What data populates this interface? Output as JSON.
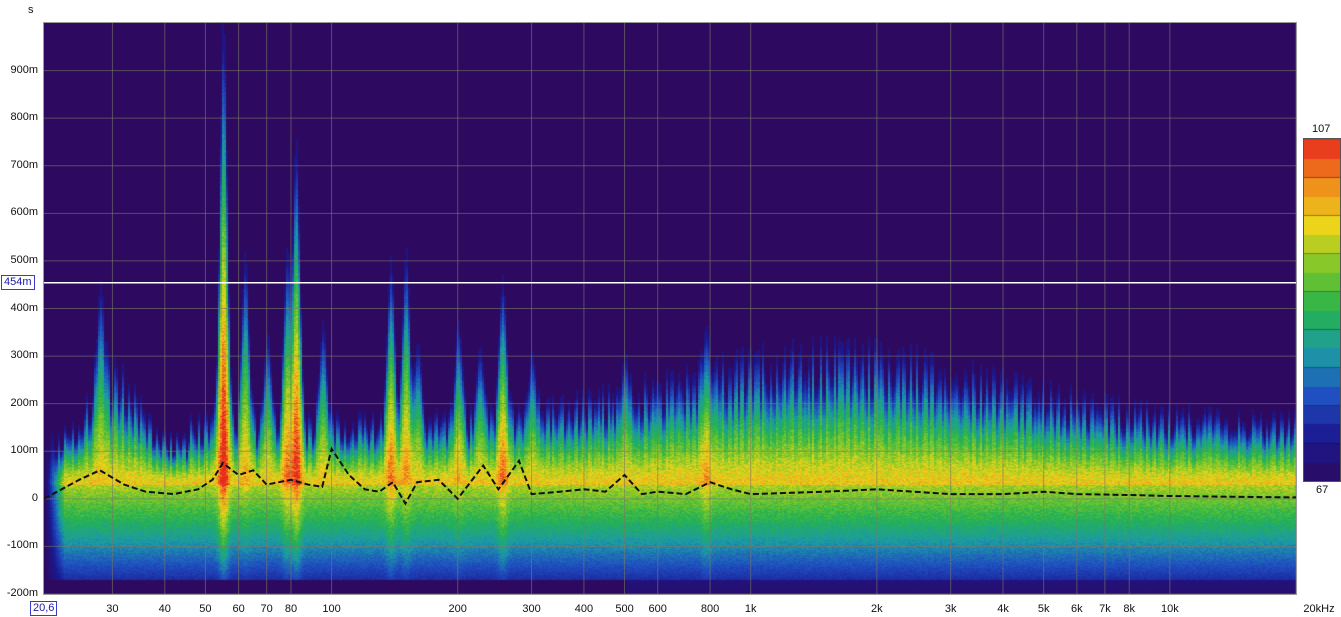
{
  "axis_labels": {
    "y_unit": "s",
    "y_ticks": [
      "900m",
      "800m",
      "700m",
      "600m",
      "500m",
      "400m",
      "300m",
      "200m",
      "100m",
      "0",
      "-100m",
      "-200m"
    ],
    "x_ticks": [
      "30",
      "40",
      "50",
      "60",
      "70",
      "80",
      "100",
      "200",
      "300",
      "400",
      "500",
      "600",
      "800",
      "1k",
      "2k",
      "3k",
      "4k",
      "5k",
      "6k",
      "7k",
      "8k",
      "10k",
      "20kHz"
    ],
    "x_start": "20,6",
    "y_cursor": "454m"
  },
  "colorbar": {
    "max_label": "107",
    "min_label": "67"
  },
  "colors": {
    "background": "#2d0a60",
    "gradient": [
      "#2d0a60",
      "#1b1890",
      "#1f4fc0",
      "#1c9aa6",
      "#26b34f",
      "#7cc72a",
      "#ecd41a",
      "#f08a1c",
      "#e8271e"
    ],
    "gridline": "#7a7a66",
    "cursor_line": "#ffffff",
    "peak_curve": "#111111"
  },
  "chart_data": {
    "type": "heatmap",
    "description_of_axes": "x: frequency (Hz, log scale); y: time (s); color: level (dB)",
    "x_scale": "log",
    "xlim_hz": [
      20.6,
      20000
    ],
    "ylim_s": [
      -0.2,
      1.0
    ],
    "x_tick_values_hz": [
      30,
      40,
      50,
      60,
      70,
      80,
      100,
      200,
      300,
      400,
      500,
      600,
      800,
      1000,
      2000,
      3000,
      4000,
      5000,
      6000,
      7000,
      8000,
      10000,
      20000
    ],
    "y_tick_values_s": [
      0.9,
      0.8,
      0.7,
      0.6,
      0.5,
      0.4,
      0.3,
      0.2,
      0.1,
      0,
      -0.1,
      -0.2
    ],
    "cursor_time_s": 0.454,
    "color_range_db": [
      67,
      107
    ],
    "decay_ridges": [
      {
        "freq_hz": 28,
        "top_s": 0.44,
        "strength": 0.7
      },
      {
        "freq_hz": 55,
        "top_s": 0.98,
        "strength": 1.0
      },
      {
        "freq_hz": 62,
        "top_s": 0.5,
        "strength": 0.75
      },
      {
        "freq_hz": 70,
        "top_s": 0.34,
        "strength": 0.6
      },
      {
        "freq_hz": 78,
        "top_s": 0.5,
        "strength": 0.85
      },
      {
        "freq_hz": 82,
        "top_s": 0.73,
        "strength": 0.95
      },
      {
        "freq_hz": 95,
        "top_s": 0.36,
        "strength": 0.7
      },
      {
        "freq_hz": 138,
        "top_s": 0.49,
        "strength": 0.85
      },
      {
        "freq_hz": 150,
        "top_s": 0.51,
        "strength": 0.8
      },
      {
        "freq_hz": 160,
        "top_s": 0.32,
        "strength": 0.7
      },
      {
        "freq_hz": 200,
        "top_s": 0.36,
        "strength": 0.75
      },
      {
        "freq_hz": 225,
        "top_s": 0.31,
        "strength": 0.7
      },
      {
        "freq_hz": 255,
        "top_s": 0.45,
        "strength": 0.85
      },
      {
        "freq_hz": 300,
        "top_s": 0.3,
        "strength": 0.7
      },
      {
        "freq_hz": 500,
        "top_s": 0.3,
        "strength": 0.7
      },
      {
        "freq_hz": 780,
        "top_s": 0.35,
        "strength": 0.8
      }
    ],
    "peak_curve": {
      "name": "",
      "x_hz": [
        20.6,
        25,
        28,
        32,
        36,
        42,
        48,
        52,
        55,
        60,
        65,
        70,
        80,
        88,
        95,
        100,
        110,
        120,
        130,
        140,
        150,
        160,
        180,
        200,
        230,
        250,
        280,
        300,
        350,
        400,
        450,
        500,
        550,
        600,
        700,
        800,
        900,
        1000,
        1500,
        2000,
        3000,
        4000,
        5000,
        6000,
        8000,
        10000,
        15000,
        20000
      ],
      "y_s": [
        0.0,
        0.04,
        0.06,
        0.03,
        0.015,
        0.01,
        0.02,
        0.04,
        0.075,
        0.05,
        0.06,
        0.03,
        0.04,
        0.03,
        0.025,
        0.105,
        0.05,
        0.02,
        0.015,
        0.035,
        -0.01,
        0.035,
        0.04,
        0.0,
        0.07,
        0.02,
        0.08,
        0.01,
        0.015,
        0.02,
        0.015,
        0.05,
        0.01,
        0.015,
        0.01,
        0.035,
        0.02,
        0.01,
        0.015,
        0.02,
        0.01,
        0.01,
        0.015,
        0.01,
        0.008,
        0.006,
        0.004,
        0.003
      ]
    }
  }
}
